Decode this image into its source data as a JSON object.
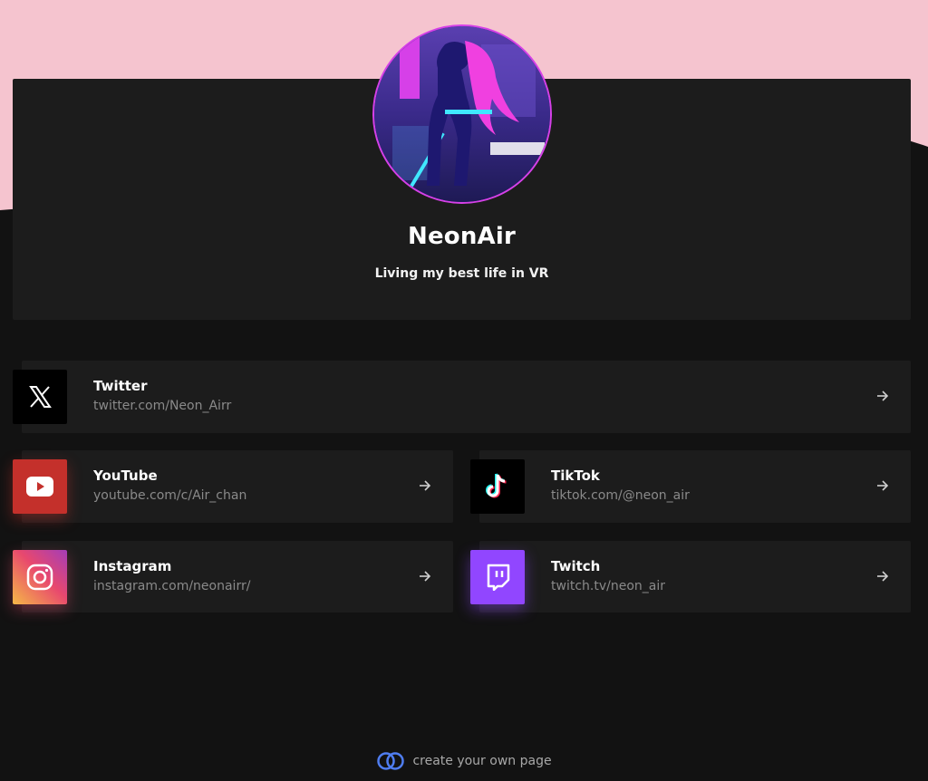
{
  "colors": {
    "background": "#121212",
    "header_background": "#f5c4cf",
    "card_background": "#1c1c1c",
    "avatar_border": "#d640e8",
    "youtube": "#c4302b",
    "twitch": "#9146ff",
    "footer_logo": "#4f7df0"
  },
  "profile": {
    "name": "NeonAir",
    "bio": "Living my best life in VR",
    "avatar_icon": "neon-character-avatar"
  },
  "links": [
    {
      "title": "Twitter",
      "url": "twitter.com/Neon_Airr",
      "icon": "x-logo-icon"
    },
    {
      "title": "YouTube",
      "url": "youtube.com/c/Air_chan",
      "icon": "youtube-icon"
    },
    {
      "title": "TikTok",
      "url": "tiktok.com/@neon_air",
      "icon": "tiktok-icon"
    },
    {
      "title": "Instagram",
      "url": "instagram.com/neonairr/",
      "icon": "instagram-icon"
    },
    {
      "title": "Twitch",
      "url": "twitch.tv/neon_air",
      "icon": "twitch-icon"
    }
  ],
  "footer": {
    "text": "create your own page",
    "icon": "linked-rings-icon"
  }
}
